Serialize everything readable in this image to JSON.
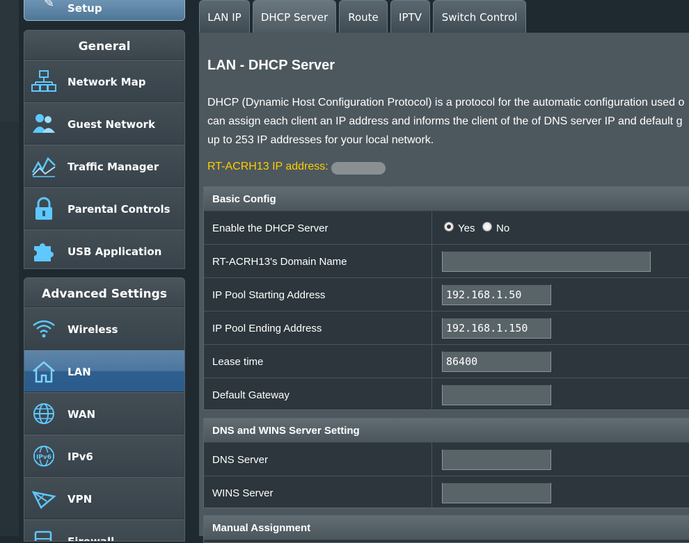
{
  "sidebar": {
    "setup_label": "Setup",
    "general": {
      "title": "General",
      "items": [
        {
          "label": "Network Map",
          "icon": "network-map-icon"
        },
        {
          "label": "Guest Network",
          "icon": "guest-network-icon"
        },
        {
          "label": "Traffic Manager",
          "icon": "traffic-manager-icon"
        },
        {
          "label": "Parental Controls",
          "icon": "lock-icon"
        },
        {
          "label": "USB Application",
          "icon": "puzzle-icon"
        }
      ]
    },
    "advanced": {
      "title": "Advanced Settings",
      "items": [
        {
          "label": "Wireless",
          "icon": "wifi-icon"
        },
        {
          "label": "LAN",
          "icon": "home-icon",
          "active": true
        },
        {
          "label": "WAN",
          "icon": "globe-icon"
        },
        {
          "label": "IPv6",
          "icon": "ipv6-globe-icon"
        },
        {
          "label": "VPN",
          "icon": "vpn-icon"
        },
        {
          "label": "Firewall",
          "icon": "firewall-icon"
        }
      ]
    }
  },
  "tabs": [
    {
      "label": "LAN IP"
    },
    {
      "label": "DHCP Server",
      "active": true
    },
    {
      "label": "Route"
    },
    {
      "label": "IPTV"
    },
    {
      "label": "Switch Control"
    }
  ],
  "main": {
    "title": "LAN - DHCP Server",
    "desc_line1": "DHCP (Dynamic Host Configuration Protocol) is a protocol for the automatic configuration used o",
    "desc_line2": "can assign each client an IP address and informs the client of the of DNS server IP and default g",
    "desc_line3": "up to 253 IP addresses for your local network.",
    "ip_label": "RT-ACRH13 IP address:"
  },
  "basic": {
    "title": "Basic Config",
    "enable_label": "Enable the DHCP Server",
    "yes_label": "Yes",
    "no_label": "No",
    "domain_label": "RT-ACRH13's Domain Name",
    "domain_value": "",
    "start_label": "IP Pool Starting Address",
    "start_value": "192.168.1.50",
    "end_label": "IP Pool Ending Address",
    "end_value": "192.168.1.150",
    "lease_label": "Lease time",
    "lease_value": "86400",
    "gateway_label": "Default Gateway",
    "gateway_value": ""
  },
  "dns": {
    "title": "DNS and WINS Server Setting",
    "dns_label": "DNS Server",
    "dns_value": "",
    "wins_label": "WINS Server",
    "wins_value": ""
  },
  "manual": {
    "title": "Manual Assignment"
  },
  "colors": {
    "ip_label": "#ffcc00",
    "active_nav": "#4c76a0"
  }
}
